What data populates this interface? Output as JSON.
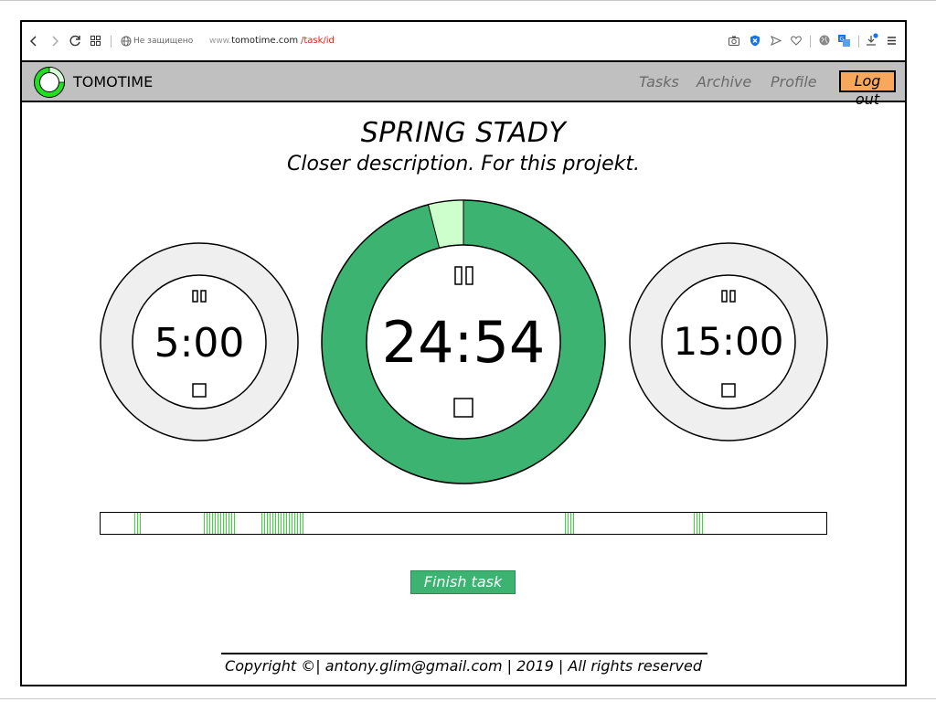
{
  "browser": {
    "security_label": "Не защищено",
    "url_prefix": "www.",
    "url_host": "tomotime.com",
    "url_path": "/task/id"
  },
  "nav": {
    "brand": "TOMOTIME",
    "links": [
      "Tasks",
      "Archive",
      "Profile"
    ],
    "logout": "Log out"
  },
  "task": {
    "title": "SPRING STADY",
    "description": "Closer description. For this projekt."
  },
  "timers": {
    "left": {
      "time": "5:00",
      "progress": 0
    },
    "center": {
      "time": "24:54",
      "progress": 0.004,
      "pause_glyph": "||",
      "stop_glyph": "□"
    },
    "right": {
      "time": "15:00",
      "progress": 0
    }
  },
  "timeline": {
    "marks": [
      [
        0.047,
        0.058
      ],
      [
        0.143,
        0.187
      ],
      [
        0.222,
        0.282
      ],
      [
        0.64,
        0.652
      ],
      [
        0.818,
        0.83
      ]
    ]
  },
  "actions": {
    "finish": "Finish task"
  },
  "footer": {
    "text": "Copyright ©| antony.glim@gmail.com | 2019 | All rights reserved"
  },
  "colors": {
    "accent": "#3db371",
    "accent_light": "#ccffcc",
    "timer_bg": "#efefef",
    "logout": "#f7a85a",
    "nav_bg": "#c0c0c0",
    "url_path": "#dd2211"
  }
}
